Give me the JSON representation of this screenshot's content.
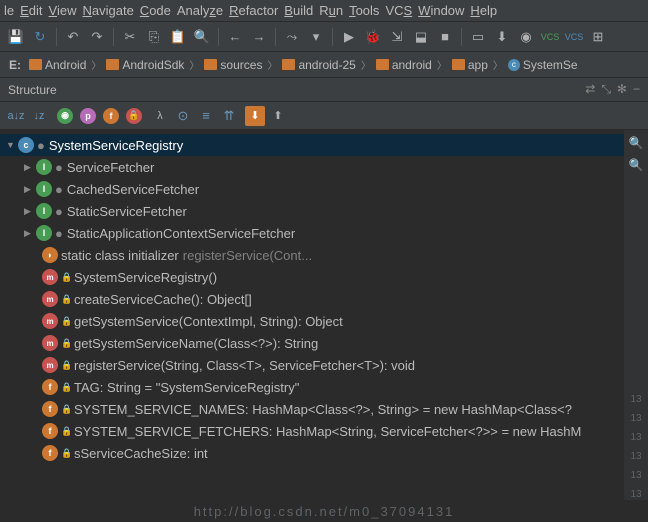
{
  "menu": {
    "items": [
      "le",
      "Edit",
      "View",
      "Navigate",
      "Code",
      "Analyze",
      "Refactor",
      "Build",
      "Run",
      "Tools",
      "VCS",
      "Window",
      "Help"
    ]
  },
  "breadcrumb": {
    "root": "E:",
    "items": [
      "Android",
      "AndroidSdk",
      "sources",
      "android-25",
      "android",
      "app",
      "SystemSe"
    ]
  },
  "panel": {
    "title": "Structure"
  },
  "tree": {
    "root": "SystemServiceRegistry",
    "children": [
      {
        "kind": "iface",
        "name": "ServiceFetcher",
        "expandable": true
      },
      {
        "kind": "iface",
        "name": "CachedServiceFetcher",
        "expandable": true
      },
      {
        "kind": "iface",
        "name": "StaticServiceFetcher",
        "expandable": true
      },
      {
        "kind": "iface",
        "name": "StaticApplicationContextServiceFetcher",
        "expandable": true
      },
      {
        "kind": "init",
        "name": "static class initializer",
        "tail": "registerService(Cont..."
      },
      {
        "kind": "method",
        "lock": true,
        "name": "SystemServiceRegistry()"
      },
      {
        "kind": "method",
        "lock": "green",
        "name": "createServiceCache(): Object[]"
      },
      {
        "kind": "method",
        "lock": "green",
        "name": "getSystemService(ContextImpl, String): Object"
      },
      {
        "kind": "method",
        "lock": "green",
        "name": "getSystemServiceName(Class<?>): String"
      },
      {
        "kind": "method",
        "lock": true,
        "name": "registerService(String, Class<T>, ServiceFetcher<T>): void"
      },
      {
        "kind": "field",
        "lock": true,
        "name": "TAG: String = \"SystemServiceRegistry\""
      },
      {
        "kind": "field",
        "lock": true,
        "name": "SYSTEM_SERVICE_NAMES: HashMap<Class<?>, String> = new HashMap<Class<?"
      },
      {
        "kind": "field",
        "lock": true,
        "name": "SYSTEM_SERVICE_FETCHERS: HashMap<String, ServiceFetcher<?>> = new HashM"
      },
      {
        "kind": "field",
        "lock": true,
        "name": "sServiceCacheSize: int"
      }
    ]
  },
  "watermark": "http://blog.csdn.net/m0_37094131",
  "linenums": [
    "13",
    "13",
    "13",
    "13",
    "13",
    "13"
  ]
}
